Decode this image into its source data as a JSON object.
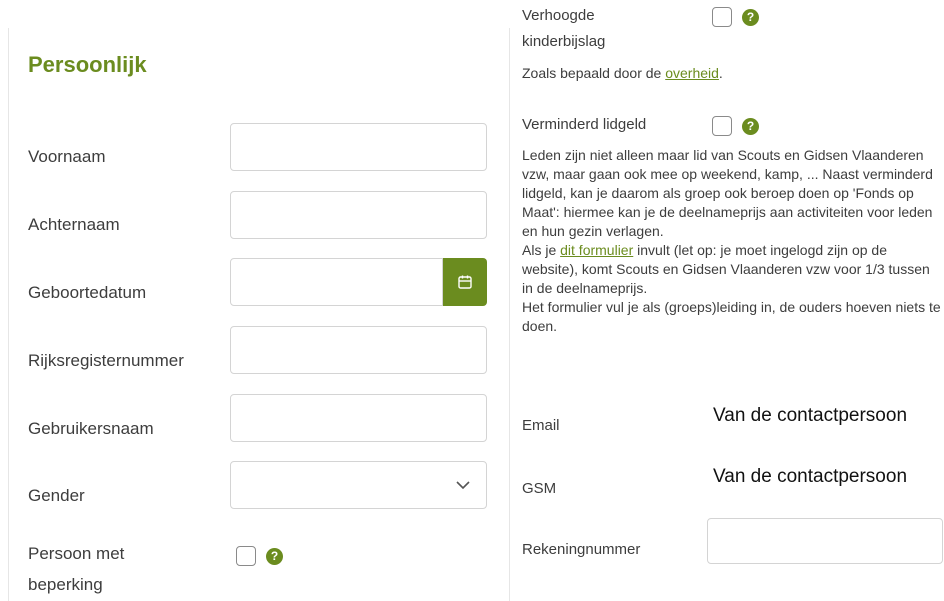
{
  "left": {
    "title": "Persoonlijk",
    "fields": {
      "first_name": "Voornaam",
      "last_name": "Achternaam",
      "birth_date": "Geboortedatum",
      "national_register": "Rijksregisternummer",
      "username": "Gebruikersnaam",
      "gender": "Gender",
      "disability_line1": "Persoon met",
      "disability_line2": "beperking"
    },
    "icons": {
      "calendar": "calendar-icon",
      "chevron": "chevron-down-icon",
      "help": "help-icon"
    }
  },
  "right": {
    "child_benefit_line1": "Verhoogde",
    "child_benefit_line2": "kinderbijslag",
    "child_benefit_note_prefix": "Zoals bepaald door de ",
    "child_benefit_note_link": "overheid",
    "child_benefit_note_suffix": ".",
    "reduced_fee_label": "Verminderd lidgeld",
    "reduced_fee_p1": "Leden zijn niet alleen maar lid van Scouts en Gidsen Vlaanderen vzw, maar gaan ook mee op weekend, kamp, ... Naast verminderd lidgeld, kan je daarom als groep ook beroep doen op 'Fonds op Maat': hiermee kan je de deelnameprijs aan activiteiten voor leden en hun gezin verlagen.",
    "reduced_fee_p2_prefix": "Als je ",
    "reduced_fee_p2_link": "dit formulier",
    "reduced_fee_p2_suffix": " invult (let op: je moet ingelogd zijn op de website), komt Scouts en Gidsen Vlaanderen vzw voor 1/3 tussen in de deelnameprijs.",
    "reduced_fee_p3": "Het formulier vul je als (groeps)leiding in, de ouders hoeven niets te doen.",
    "email_label": "Email",
    "email_value": "Van de contactpersoon",
    "gsm_label": "GSM",
    "gsm_value": "Van de contactpersoon",
    "account_label": "Rekeningnummer"
  },
  "colors": {
    "accent": "#6b8c1f",
    "text": "#3d3d3d",
    "border": "#d4d4d4"
  }
}
